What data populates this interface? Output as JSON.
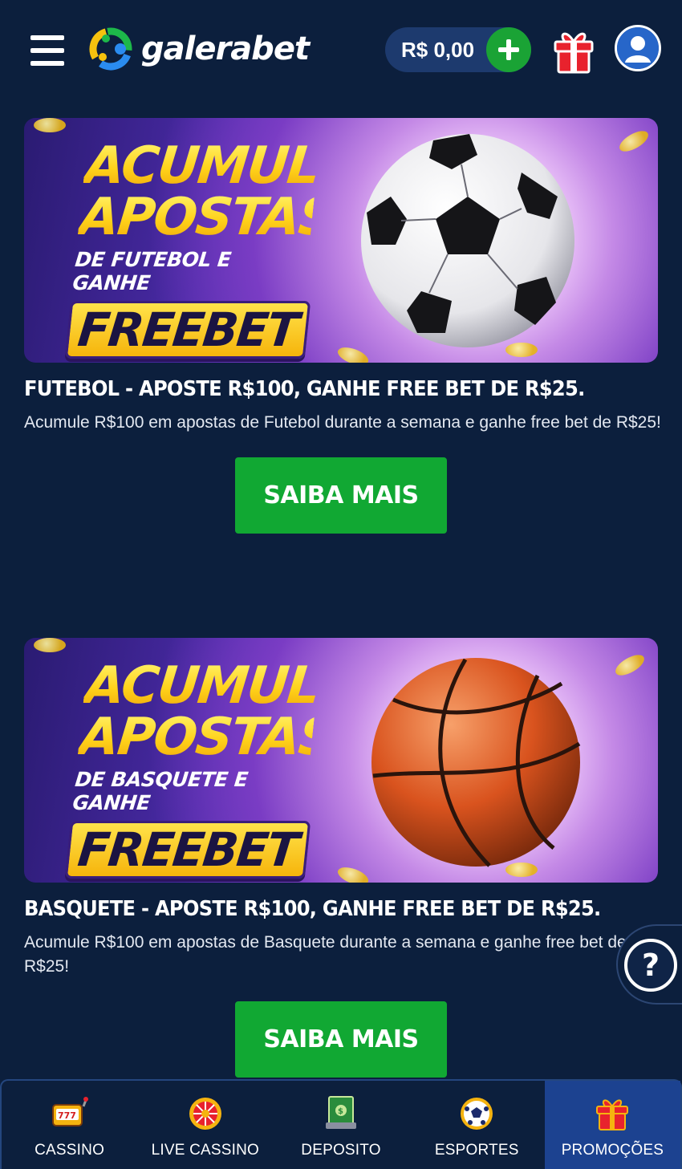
{
  "header": {
    "logo_text": "galerabet",
    "balance": "R$ 0,00"
  },
  "promos": [
    {
      "banner": {
        "line1": "ACUMULE",
        "line2": "APOSTAS",
        "sub": "DE FUTEBOL E GANHE",
        "freebet": "FREEBET",
        "ball": "soccer-ball"
      },
      "title": "FUTEBOL - APOSTE R$100, GANHE FREE BET DE R$25.",
      "description": "Acumule R$100 em apostas de Futebol durante a semana e ganhe free bet de R$25!",
      "button": "SAIBA MAIS"
    },
    {
      "banner": {
        "line1": "ACUMULE",
        "line2": "APOSTAS",
        "sub": "DE BASQUETE E GANHE",
        "freebet": "FREEBET",
        "ball": "basketball"
      },
      "title": "BASQUETE - APOSTE R$100, GANHE FREE BET DE R$25.",
      "description": "Acumule R$100 em apostas de Basquete durante a semana e ganhe free bet de R$25!",
      "button": "SAIBA MAIS"
    }
  ],
  "help": {
    "label": "?"
  },
  "bottom_nav": {
    "items": [
      {
        "label": "CASSINO",
        "icon": "slot-machine-icon"
      },
      {
        "label": "LIVE CASSINO",
        "icon": "roulette-icon"
      },
      {
        "label": "DEPOSITO",
        "icon": "cash-icon"
      },
      {
        "label": "ESPORTES",
        "icon": "soccer-ball-icon"
      },
      {
        "label": "PROMOÇÕES",
        "icon": "gift-icon"
      }
    ],
    "active": "PROMOÇÕES"
  },
  "colors": {
    "background": "#0c1f3d",
    "primary_button": "#11a833",
    "active_nav": "#1c4290",
    "balance_pill": "#1d3a6e",
    "freebet_yellow": "#ffd21a"
  }
}
